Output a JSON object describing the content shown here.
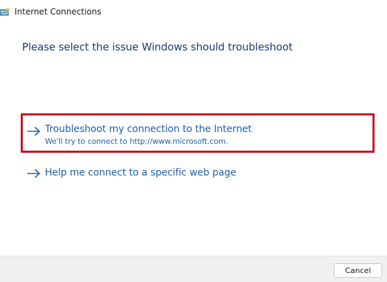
{
  "window": {
    "title": "Internet Connections",
    "app_icon": "network-troubleshooter-icon"
  },
  "main": {
    "heading": "Please select the issue Windows should troubleshoot",
    "options": [
      {
        "title": "Troubleshoot my connection to the Internet",
        "subtitle": "We'll try to connect to http://www.microsoft.com.",
        "icon": "arrow-right-icon",
        "highlighted": true
      },
      {
        "title": "Help me connect to a specific web page",
        "icon": "arrow-right-icon",
        "highlighted": false
      }
    ]
  },
  "footer": {
    "cancel_label": "Cancel"
  },
  "colors": {
    "heading": "#1e3a78",
    "link": "#1f5fa8",
    "highlight_border": "#c8101c",
    "footer_bg": "#f0f0f0"
  }
}
